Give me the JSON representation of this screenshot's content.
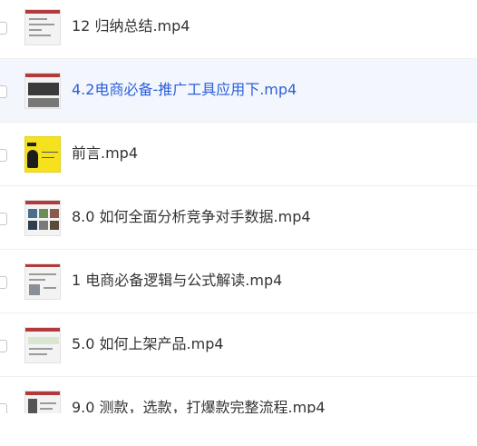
{
  "files": [
    {
      "name": "12 归纳总结.mp4",
      "thumb_icon": "video-thumbnail-icon",
      "selected": false
    },
    {
      "name": "4.2电商必备-推广工具应用下.mp4",
      "thumb_icon": "video-thumbnail-icon",
      "selected": true
    },
    {
      "name": "前言.mp4",
      "thumb_icon": "video-thumbnail-icon",
      "selected": false
    },
    {
      "name": "8.0 如何全面分析竞争对手数据.mp4",
      "thumb_icon": "video-thumbnail-icon",
      "selected": false
    },
    {
      "name": "1 电商必备逻辑与公式解读.mp4",
      "thumb_icon": "video-thumbnail-icon",
      "selected": false
    },
    {
      "name": "5.0 如何上架产品.mp4",
      "thumb_icon": "video-thumbnail-icon",
      "selected": false
    },
    {
      "name": "9.0 测款，选款，打爆款完整流程.mp4",
      "thumb_icon": "video-thumbnail-icon",
      "selected": false
    }
  ],
  "colors": {
    "selected_text": "#2b5fd9",
    "selected_bg": "#f4f6fd",
    "text": "#333333"
  }
}
